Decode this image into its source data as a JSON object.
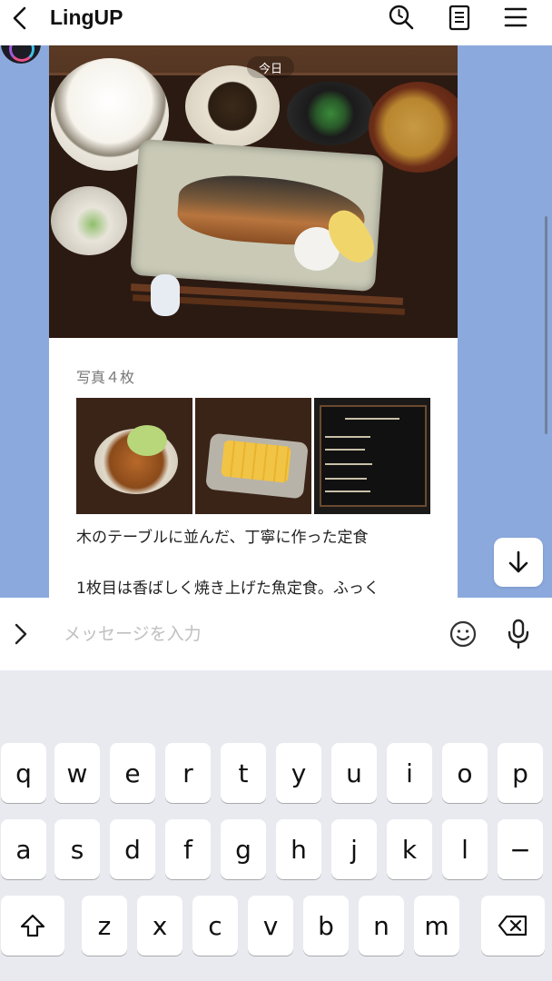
{
  "header": {
    "title": "LingUP"
  },
  "chat": {
    "date_chip": "今日",
    "photo_count_label": "写真４枚",
    "message_text": "木のテーブルに並んだ、丁寧に作った定食\n\n1枚目は香ばしく焼き上げた魚定食。ふっく"
  },
  "input": {
    "placeholder": "メッセージを入力",
    "value": ""
  },
  "keyboard": {
    "row1": [
      "q",
      "w",
      "e",
      "r",
      "t",
      "y",
      "u",
      "i",
      "o",
      "p"
    ],
    "row2": [
      "a",
      "s",
      "d",
      "f",
      "g",
      "h",
      "j",
      "k",
      "l",
      "−"
    ],
    "row3": [
      "z",
      "x",
      "c",
      "v",
      "b",
      "n",
      "m"
    ]
  },
  "icons": {
    "back": "chevron-left-icon",
    "search": "search-icon",
    "notes": "note-icon",
    "menu": "menu-icon",
    "scroll_down": "arrow-down-icon",
    "expand": "chevron-right-icon",
    "emoji": "emoji-icon",
    "mic": "microphone-icon",
    "shift": "shift-icon",
    "backspace": "backspace-icon"
  },
  "colors": {
    "chat_background": "#8ba9dd",
    "bubble": "#ffffff",
    "keyboard": "#e8eaef"
  }
}
